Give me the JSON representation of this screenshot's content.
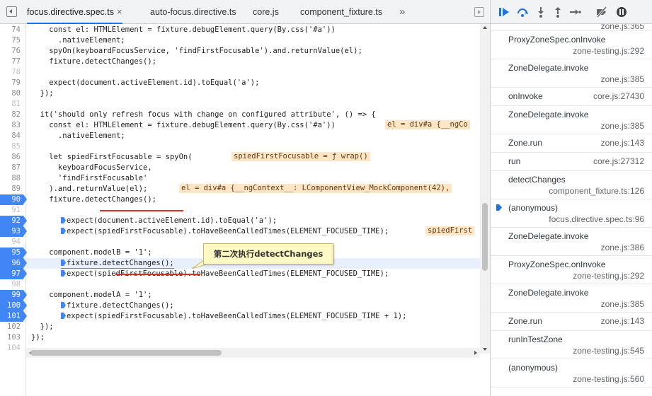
{
  "tabs": [
    {
      "label": "focus.directive.spec.ts",
      "active": true,
      "close": "×"
    },
    {
      "label": "auto-focus.directive.ts",
      "active": false
    },
    {
      "label": "core.js",
      "active": false
    },
    {
      "label": "component_fixture.ts",
      "active": false
    }
  ],
  "tabs_more": "»",
  "code_lines": [
    {
      "n": "74",
      "text": "    const el: HTMLElement = fixture.debugElement.query(By.css('#a'))"
    },
    {
      "n": "75",
      "text": "      .nativeElement;"
    },
    {
      "n": "76",
      "text": "    spyOn(keyboardFocusService, 'findFirstFocusable').and.returnValue(el);"
    },
    {
      "n": "77",
      "text": "    fixture.detectChanges();"
    },
    {
      "n": "78",
      "text": ""
    },
    {
      "n": "79",
      "text": "    expect(document.activeElement.id).toEqual('a');"
    },
    {
      "n": "80",
      "text": "  });"
    },
    {
      "n": "81",
      "text": ""
    },
    {
      "n": "82",
      "text": "  it('should only refresh focus with change on configured attribute', () => {"
    },
    {
      "n": "83",
      "text": "    const el: HTMLElement = fixture.debugElement.query(By.css('#a'))"
    },
    {
      "n": "84",
      "text": "      .nativeElement;"
    },
    {
      "n": "85",
      "text": ""
    },
    {
      "n": "86",
      "text": "    let spiedFirstFocusable = spyOn("
    },
    {
      "n": "87",
      "text": "      keyboardFocusService,"
    },
    {
      "n": "88",
      "text": "      'findFirstFocusable'"
    },
    {
      "n": "89",
      "text": "    ).and.returnValue(el);"
    },
    {
      "n": "90",
      "text": "    fixture.detectChanges();"
    },
    {
      "n": "91",
      "text": ""
    },
    {
      "n": "92",
      "text": "    expect(document.activeElement.id).toEqual('a');"
    },
    {
      "n": "93",
      "text": "    expect(spiedFirstFocusable).toHaveBeenCalledTimes(ELEMENT_FOCUSED_TIME);"
    },
    {
      "n": "94",
      "text": ""
    },
    {
      "n": "95",
      "text": "    component.modelB = '1';"
    },
    {
      "n": "96",
      "text": "    fixture.detectChanges();"
    },
    {
      "n": "97",
      "text": "    expect(spiedFirstFocusable).toHaveBeenCalledTimes(ELEMENT_FOCUSED_TIME);"
    },
    {
      "n": "98",
      "text": ""
    },
    {
      "n": "99",
      "text": "    component.modelA = '1';"
    },
    {
      "n": "100",
      "text": "    fixture.detectChanges();"
    },
    {
      "n": "101",
      "text": "    expect(spiedFirstFocusable).toHaveBeenCalledTimes(ELEMENT_FOCUSED_TIME + 1);"
    },
    {
      "n": "102",
      "text": "  });"
    },
    {
      "n": "103",
      "text": "});"
    },
    {
      "n": "104",
      "text": ""
    }
  ],
  "inline_values": {
    "line83": "el = div#a {__ngCo",
    "line86": "spiedFirstFocusable = ƒ wrap()",
    "line89": "el = div#a {__ngContext__: LComponentView_MockComponent(42),",
    "line93": "spiedFirst"
  },
  "annotation": "第二次执行detectChanges",
  "call_stack": [
    {
      "name": "",
      "loc": "zone.js:365"
    },
    {
      "name": "ProxyZoneSpec.onInvoke",
      "loc": "zone-testing.js:292"
    },
    {
      "name": "ZoneDelegate.invoke",
      "loc": "zone.js:385"
    },
    {
      "name": "onInvoke",
      "loc": "core.js:27430"
    },
    {
      "name": "ZoneDelegate.invoke",
      "loc": "zone.js:385"
    },
    {
      "name": "Zone.run",
      "loc": "zone.js:143"
    },
    {
      "name": "run",
      "loc": "core.js:27312"
    },
    {
      "name": "detectChanges",
      "loc": "component_fixture.ts:126"
    },
    {
      "name": "(anonymous)",
      "loc": "focus.directive.spec.ts:96"
    },
    {
      "name": "ZoneDelegate.invoke",
      "loc": "zone.js:386"
    },
    {
      "name": "ProxyZoneSpec.onInvoke",
      "loc": "zone-testing.js:292"
    },
    {
      "name": "ZoneDelegate.invoke",
      "loc": "zone.js:385"
    },
    {
      "name": "Zone.run",
      "loc": "zone.js:143"
    },
    {
      "name": "runInTestZone",
      "loc": "zone-testing.js:545"
    },
    {
      "name": "(anonymous)",
      "loc": "zone-testing.js:560"
    }
  ],
  "colors": {
    "breakpoint": "#4285f4",
    "active_tab": "#1a73e8",
    "inline_value_bg": "#ffe5c4",
    "annotation_bg": "#fff9c4",
    "underline": "#d93025"
  },
  "debug_toolbar_icons": [
    "resume-icon",
    "step-over-icon",
    "step-into-icon",
    "step-out-icon",
    "step-icon",
    "deactivate-breakpoints-icon",
    "pause-on-exceptions-icon"
  ]
}
